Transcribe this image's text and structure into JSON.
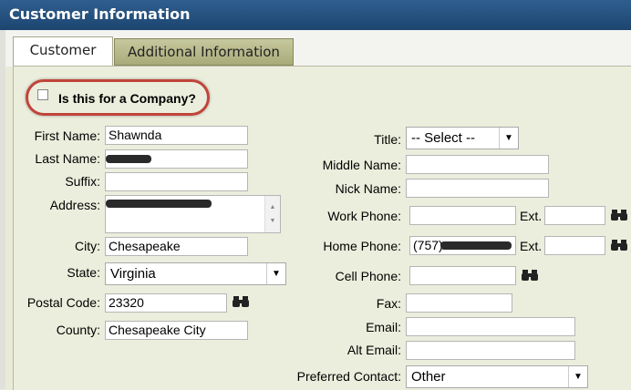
{
  "window": {
    "title": "Customer Information"
  },
  "tabs": [
    {
      "label": "Customer",
      "active": true
    },
    {
      "label": "Additional Information",
      "active": false
    }
  ],
  "company_toggle": {
    "label": "Is this for a Company?",
    "checked": false
  },
  "left_form": {
    "first_name": {
      "label": "First Name:",
      "value": "Shawnda"
    },
    "last_name": {
      "label": "Last Name:",
      "value": ""
    },
    "suffix": {
      "label": "Suffix:",
      "value": ""
    },
    "address": {
      "label": "Address:",
      "value": ""
    },
    "city": {
      "label": "City:",
      "value": "Chesapeake"
    },
    "state": {
      "label": "State:",
      "value": "Virginia"
    },
    "postal_code": {
      "label": "Postal Code:",
      "value": "23320"
    },
    "county": {
      "label": "County:",
      "value": "Chesapeake City"
    }
  },
  "right_form": {
    "title": {
      "label": "Title:",
      "value": "-- Select --"
    },
    "middle_name": {
      "label": "Middle Name:",
      "value": ""
    },
    "nick_name": {
      "label": "Nick Name:",
      "value": ""
    },
    "work_phone": {
      "label": "Work Phone:",
      "value": "",
      "ext_label": "Ext.",
      "ext_value": ""
    },
    "home_phone": {
      "label": "Home Phone:",
      "value": "(757)",
      "ext_label": "Ext.",
      "ext_value": ""
    },
    "cell_phone": {
      "label": "Cell Phone:",
      "value": ""
    },
    "fax": {
      "label": "Fax:",
      "value": ""
    },
    "email": {
      "label": "Email:",
      "value": ""
    },
    "alt_email": {
      "label": "Alt Email:",
      "value": ""
    },
    "preferred_contact": {
      "label": "Preferred Contact:",
      "value": "Other"
    }
  },
  "colors": {
    "header": "#1d4570",
    "highlight_oval": "#c0443a",
    "tab_inactive": "#b4b688"
  }
}
